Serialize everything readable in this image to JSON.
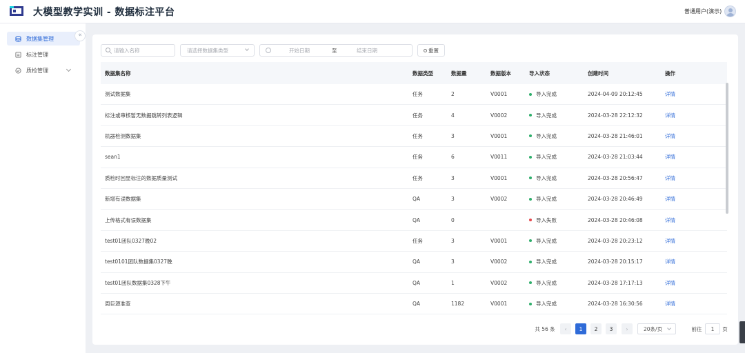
{
  "header": {
    "title": "大模型教学实训 - 数据标注平台",
    "user": "普通用户(演示)"
  },
  "sidebar": {
    "collapse_glyph": "«",
    "items": [
      {
        "label": "数据集管理",
        "icon": "database-icon",
        "active": true
      },
      {
        "label": "标注管理",
        "icon": "tag-list-icon",
        "active": false
      },
      {
        "label": "质检管理",
        "icon": "check-circle-icon",
        "active": false
      }
    ]
  },
  "filters": {
    "search_placeholder": "请输入名称",
    "type_placeholder": "请选择数据集类型",
    "start_date_placeholder": "开始日期",
    "range_separator": "至",
    "end_date_placeholder": "结束日期",
    "reset_label": "重置"
  },
  "table": {
    "columns": [
      "数据集名称",
      "数据类型",
      "数据量",
      "数据版本",
      "导入状态",
      "创建时间",
      "操作"
    ],
    "rows": [
      {
        "name": "测试数据集",
        "type": "任务",
        "count": "2",
        "version": "V0001",
        "status": "导入完成",
        "status_ok": true,
        "created": "2024-04-09 20:12:45",
        "action": "详情"
      },
      {
        "name": "标注或审核暂无数据跳转列表逻辑",
        "type": "任务",
        "count": "4",
        "version": "V0002",
        "status": "导入完成",
        "status_ok": true,
        "created": "2024-03-28 22:12:32",
        "action": "详情"
      },
      {
        "name": "机器检测数据集",
        "type": "任务",
        "count": "3",
        "version": "V0001",
        "status": "导入完成",
        "status_ok": true,
        "created": "2024-03-28 21:46:01",
        "action": "详情"
      },
      {
        "name": "sean1",
        "type": "任务",
        "count": "6",
        "version": "V0011",
        "status": "导入完成",
        "status_ok": true,
        "created": "2024-03-28 21:03:44",
        "action": "详情"
      },
      {
        "name": "质检时回显标注的数据质量测试",
        "type": "任务",
        "count": "3",
        "version": "V0001",
        "status": "导入完成",
        "status_ok": true,
        "created": "2024-03-28 20:56:47",
        "action": "详情"
      },
      {
        "name": "新增有误数据集",
        "type": "QA",
        "count": "3",
        "version": "V0002",
        "status": "导入完成",
        "status_ok": true,
        "created": "2024-03-28 20:46:49",
        "action": "详情"
      },
      {
        "name": "上传格式有误数据集",
        "type": "QA",
        "count": "0",
        "version": "",
        "status": "导入失败",
        "status_ok": false,
        "created": "2024-03-28 20:46:08",
        "action": "详情"
      },
      {
        "name": "test01团队0327晚02",
        "type": "任务",
        "count": "3",
        "version": "V0001",
        "status": "导入完成",
        "status_ok": true,
        "created": "2024-03-28 20:23:12",
        "action": "详情"
      },
      {
        "name": "test0101团队数据集0327晚",
        "type": "QA",
        "count": "3",
        "version": "V0002",
        "status": "导入完成",
        "status_ok": true,
        "created": "2024-03-28 20:15:17",
        "action": "详情"
      },
      {
        "name": "test01团队数据集0328下午",
        "type": "QA",
        "count": "1",
        "version": "V0002",
        "status": "导入完成",
        "status_ok": true,
        "created": "2024-03-28 17:17:13",
        "action": "详情"
      },
      {
        "name": "周巨源准查",
        "type": "QA",
        "count": "1182",
        "version": "V0001",
        "status": "导入完成",
        "status_ok": true,
        "created": "2024-03-28 16:30:56",
        "action": "详情"
      }
    ]
  },
  "pagination": {
    "total": "共 56 条",
    "prev": "‹",
    "pages": [
      "1",
      "2",
      "3"
    ],
    "current_page": "1",
    "next": "›",
    "page_size": "20条/页",
    "goto_label": "前往",
    "goto_value": "1",
    "goto_suffix": "页"
  },
  "colors": {
    "accent": "#2f6bd8",
    "status_ok": "#2fae6b",
    "status_fail": "#e5484d"
  }
}
